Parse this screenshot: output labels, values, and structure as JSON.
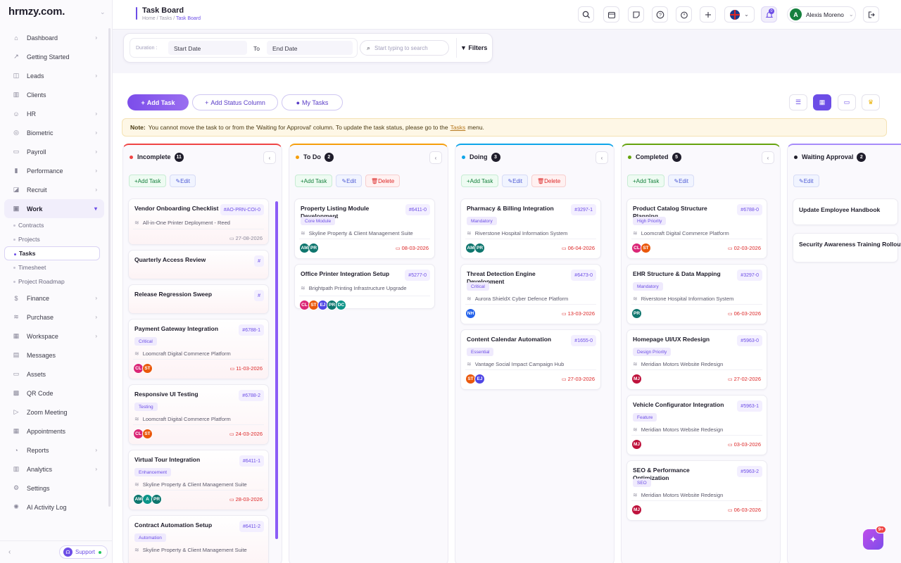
{
  "brand": {
    "logo": "hrmzy.com."
  },
  "sidebar": {
    "items": [
      {
        "label": "Dashboard",
        "icon": "dashboard-icon",
        "arrow": true
      },
      {
        "label": "Getting Started",
        "icon": "rocket-icon",
        "arrow": false
      },
      {
        "label": "Leads",
        "icon": "leads-icon",
        "arrow": true
      },
      {
        "label": "Clients",
        "icon": "clients-icon",
        "arrow": false
      },
      {
        "label": "HR",
        "icon": "hr-icon",
        "arrow": true
      },
      {
        "label": "Biometric",
        "icon": "fingerprint-icon",
        "arrow": true
      },
      {
        "label": "Payroll",
        "icon": "payroll-icon",
        "arrow": true
      },
      {
        "label": "Performance",
        "icon": "performance-icon",
        "arrow": true
      },
      {
        "label": "Recruit",
        "icon": "recruit-icon",
        "arrow": true
      },
      {
        "label": "Work",
        "icon": "briefcase-icon",
        "arrow": true
      }
    ],
    "work_sub": [
      "Contracts",
      "Projects",
      "Tasks",
      "Timesheet",
      "Project Roadmap"
    ],
    "items2": [
      {
        "label": "Finance",
        "icon": "dollar-icon",
        "arrow": true
      },
      {
        "label": "Purchase",
        "icon": "layers-icon",
        "arrow": true
      },
      {
        "label": "Workspace",
        "icon": "grid-icon",
        "arrow": true
      },
      {
        "label": "Messages",
        "icon": "messages-icon",
        "arrow": false
      },
      {
        "label": "Assets",
        "icon": "monitor-icon",
        "arrow": false
      },
      {
        "label": "QR Code",
        "icon": "qr-icon",
        "arrow": false
      },
      {
        "label": "Zoom Meeting",
        "icon": "video-icon",
        "arrow": false
      },
      {
        "label": "Appointments",
        "icon": "appointment-icon",
        "arrow": false
      },
      {
        "label": "Reports",
        "icon": "reports-icon",
        "arrow": true
      },
      {
        "label": "Analytics",
        "icon": "analytics-icon",
        "arrow": true
      },
      {
        "label": "Settings",
        "icon": "settings-icon",
        "arrow": false
      },
      {
        "label": "AI Activity Log",
        "icon": "ai-icon",
        "arrow": false
      }
    ],
    "support": "Support"
  },
  "header": {
    "title": "Task Board",
    "crumbs": [
      "Home",
      "Tasks",
      "Task Board"
    ],
    "user": {
      "initial": "A",
      "name": "Alexis Moreno"
    },
    "notif_count": "0"
  },
  "filters": {
    "duration_label": "Duration :",
    "start": "Start Date",
    "to": "To",
    "end": "End Date",
    "search_placeholder": "Start typing to search",
    "filters": "Filters"
  },
  "toolbar": {
    "add_task": "Add Task",
    "add_status": "Add Status Column",
    "my_tasks": "My Tasks"
  },
  "note": {
    "bold": "Note:",
    "text": "You cannot move the task to or from the 'Waiting for Approval' column. To update the task status, please go to the",
    "link": "Tasks",
    "tail": "menu."
  },
  "actions": {
    "add": "Add Task",
    "edit": "Edit",
    "delete": "Delete"
  },
  "columns": [
    {
      "name": "Incomplete",
      "count": "11",
      "color": "#ef4444",
      "cards": [
        {
          "title": "Vendor Onboarding Checklist",
          "id": "#AO-PRN-COI-0",
          "tag": "",
          "project": "All-in-One Printer Deployment - Reed",
          "avatars": [],
          "due": "27-08-2026"
        },
        {
          "title": "Quarterly Access Review",
          "id": "#",
          "tag": "",
          "project": "",
          "avatars": [],
          "due": ""
        },
        {
          "title": "Release Regression Sweep",
          "id": "#",
          "tag": "",
          "project": "",
          "avatars": [],
          "due": ""
        },
        {
          "title": "Payment Gateway Integration",
          "id": "#6788-1",
          "tag": "Critical",
          "project": "Loomcraft Digital Commerce Platform",
          "avatars": [
            {
              "t": "CL",
              "c": "#db2777"
            },
            {
              "t": "ST",
              "c": "#ea580c"
            }
          ],
          "due": "11-03-2026"
        },
        {
          "title": "Responsive UI Testing",
          "id": "#6788-2",
          "tag": "Testing",
          "project": "Loomcraft Digital Commerce Platform",
          "avatars": [
            {
              "t": "CL",
              "c": "#db2777"
            },
            {
              "t": "ST",
              "c": "#ea580c"
            }
          ],
          "due": "24-03-2026"
        },
        {
          "title": "Virtual Tour Integration",
          "id": "#6411-1",
          "tag": "Enhancement",
          "project": "Skyline Property & Client Management Suite",
          "avatars": [
            {
              "t": "AM",
              "c": "#0f766e"
            },
            {
              "t": "A",
              "c": "#0d9488"
            },
            {
              "t": "PR",
              "c": "#0f766e"
            }
          ],
          "due": "28-03-2026"
        },
        {
          "title": "Contract Automation Setup",
          "id": "#6411-2",
          "tag": "Automation",
          "project": "Skyline Property & Client Management Suite",
          "avatars": [],
          "due": ""
        }
      ]
    },
    {
      "name": "To Do",
      "count": "2",
      "color": "#f59e0b",
      "cards": [
        {
          "title": "Property Listing Module Development",
          "id": "#6411-0",
          "tag": "Core Module",
          "project": "Skyline Property & Client Management Suite",
          "avatars": [
            {
              "t": "AM",
              "c": "#0f766e"
            },
            {
              "t": "PR",
              "c": "#0f766e"
            }
          ],
          "due": "08-03-2026"
        },
        {
          "title": "Office Printer Integration Setup",
          "id": "#5277-0",
          "tag": "",
          "project": "Brightpath Printing Infrastructure Upgrade",
          "avatars": [
            {
              "t": "CL",
              "c": "#db2777"
            },
            {
              "t": "ST",
              "c": "#ea580c"
            },
            {
              "t": "EJ",
              "c": "#4f46e5"
            },
            {
              "t": "PR",
              "c": "#0f766e"
            },
            {
              "t": "DC",
              "c": "#0d9488"
            }
          ],
          "due": ""
        }
      ]
    },
    {
      "name": "Doing",
      "count": "3",
      "color": "#0ea5e9",
      "cards": [
        {
          "title": "Pharmacy & Billing Integration",
          "id": "#3297-1",
          "tag": "Mandatory",
          "project": "Riverstone Hospital Information System",
          "avatars": [
            {
              "t": "AM",
              "c": "#0f766e"
            },
            {
              "t": "PR",
              "c": "#0f766e"
            }
          ],
          "due": "06-04-2026"
        },
        {
          "title": "Threat Detection Engine Development",
          "id": "#6473-0",
          "tag": "Critical",
          "project": "Aurora ShieldX Cyber Defence Platform",
          "avatars": [
            {
              "t": "NH",
              "c": "#2563eb"
            }
          ],
          "due": "13-03-2026"
        },
        {
          "title": "Content Calendar Automation",
          "id": "#1655-0",
          "tag": "Essential",
          "project": "Vantage Social Impact Campaign Hub",
          "avatars": [
            {
              "t": "ST",
              "c": "#ea580c"
            },
            {
              "t": "EJ",
              "c": "#4f46e5"
            }
          ],
          "due": "27-03-2026"
        }
      ]
    },
    {
      "name": "Completed",
      "count": "5",
      "color": "#65a30d",
      "cards": [
        {
          "title": "Product Catalog Structure Planning",
          "id": "#6788-0",
          "tag": "High Priority",
          "project": "Loomcraft Digital Commerce Platform",
          "avatars": [
            {
              "t": "CL",
              "c": "#db2777"
            },
            {
              "t": "ST",
              "c": "#ea580c"
            }
          ],
          "due": "02-03-2026"
        },
        {
          "title": "EHR Structure & Data Mapping",
          "id": "#3297-0",
          "tag": "Mandatory",
          "project": "Riverstone Hospital Information System",
          "avatars": [
            {
              "t": "PR",
              "c": "#0f766e"
            }
          ],
          "due": "06-03-2026"
        },
        {
          "title": "Homepage UI/UX Redesign",
          "id": "#5963-0",
          "tag": "Design Priority",
          "project": "Meridian Motors Website Redesign",
          "avatars": [
            {
              "t": "MJ",
              "c": "#be123c"
            }
          ],
          "due": "27-02-2026"
        },
        {
          "title": "Vehicle Configurator Integration",
          "id": "#5963-1",
          "tag": "Feature",
          "project": "Meridian Motors Website Redesign",
          "avatars": [
            {
              "t": "MJ",
              "c": "#be123c"
            }
          ],
          "due": "03-03-2026"
        },
        {
          "title": "SEO & Performance Optimization",
          "id": "#5963-2",
          "tag": "SEO",
          "project": "Meridian Motors Website Redesign",
          "avatars": [
            {
              "t": "MJ",
              "c": "#be123c"
            }
          ],
          "due": "06-03-2026"
        }
      ]
    },
    {
      "name": "Waiting Approval",
      "count": "2",
      "color": "#1f1d2b",
      "cards": [
        {
          "title": "Update Employee Handbook",
          "id": "",
          "tag": "",
          "project": "",
          "avatars": [],
          "due": ""
        },
        {
          "title": "Security Awareness Training Rollout",
          "id": "",
          "tag": "",
          "project": "",
          "avatars": [],
          "due": ""
        }
      ]
    }
  ],
  "fab_badge": "9+"
}
